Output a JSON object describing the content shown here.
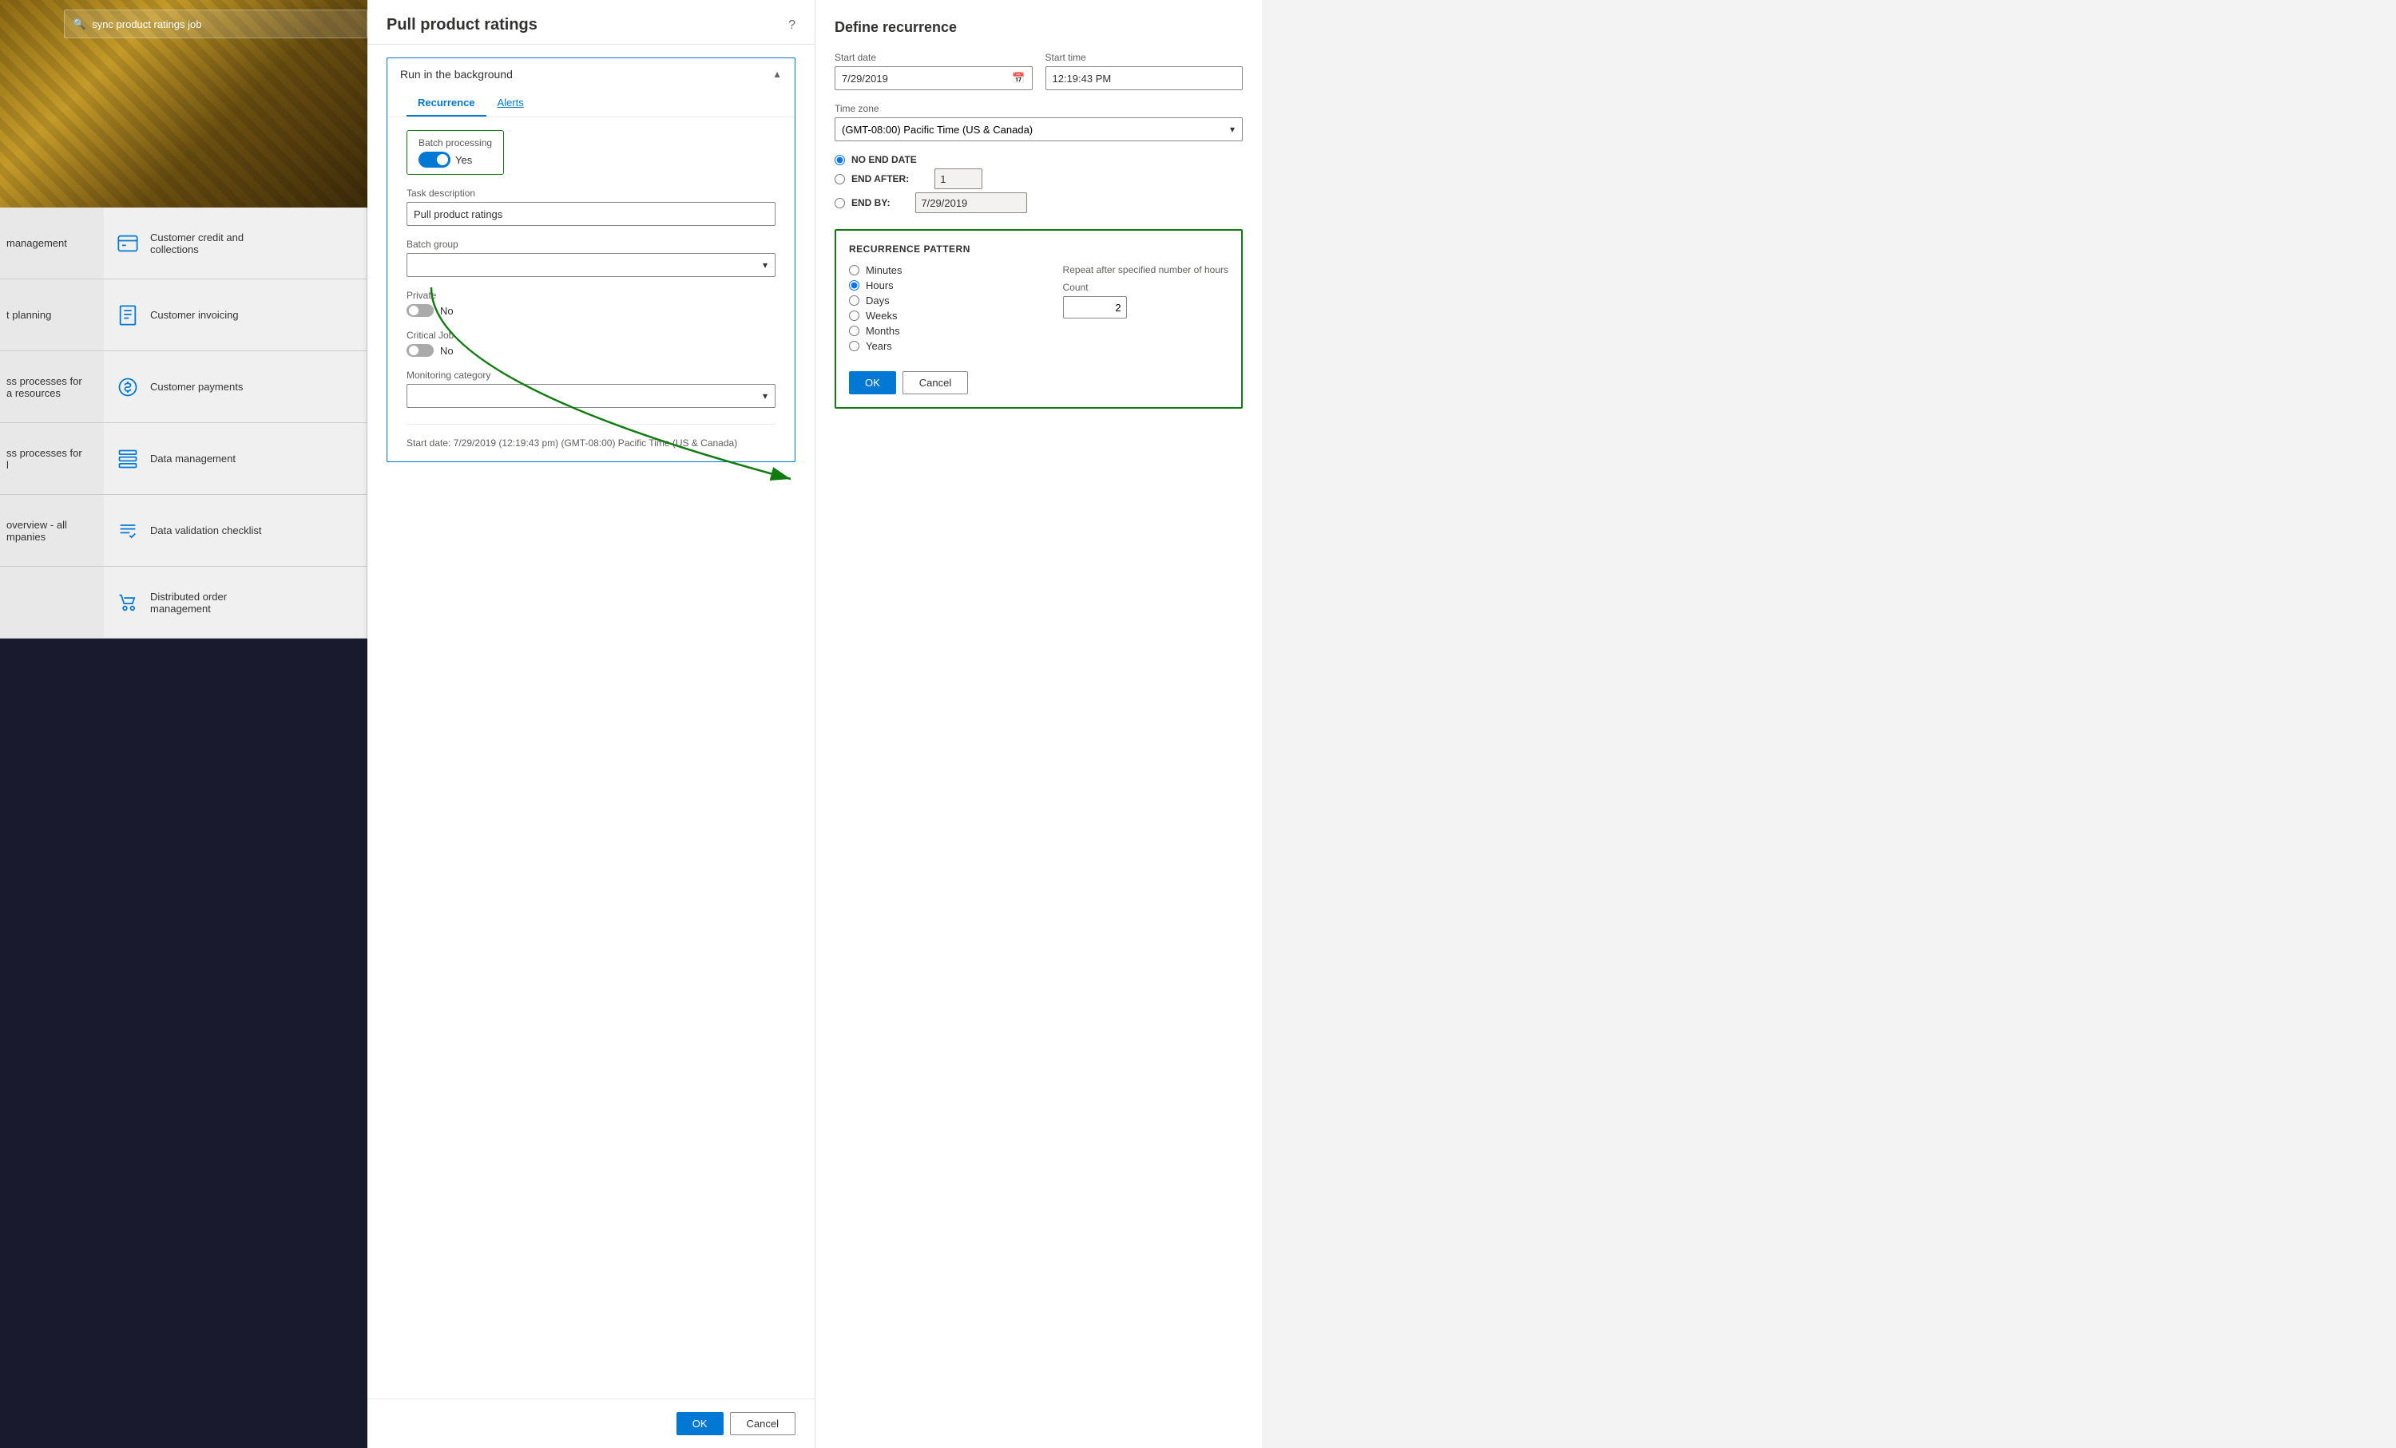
{
  "search": {
    "placeholder": "sync product ratings job",
    "value": "sync product ratings job"
  },
  "nav": {
    "left_tiles": [
      {
        "label": "management"
      },
      {
        "label": "t planning"
      },
      {
        "label": "ss processes for\na resources"
      },
      {
        "label": "ss processes for\nl"
      },
      {
        "label": "overview - all\nmpanies"
      },
      {
        "label": ""
      }
    ],
    "mid_tiles": [
      {
        "label": "Customer credit and\ncollections",
        "icon": "billing-icon"
      },
      {
        "label": "Customer invoicing",
        "icon": "invoice-icon"
      },
      {
        "label": "Customer payments",
        "icon": "payment-icon"
      },
      {
        "label": "Data management",
        "icon": "data-icon"
      },
      {
        "label": "Data validation checklist",
        "icon": "checklist-icon"
      },
      {
        "label": "Distributed order\nmanagement",
        "icon": "order-icon"
      }
    ]
  },
  "pull_dialog": {
    "title": "Pull product ratings",
    "help_icon": "?",
    "run_in_background": {
      "label": "Run in the background",
      "expanded": true
    },
    "tabs": [
      {
        "label": "Recurrence",
        "active": true
      },
      {
        "label": "Alerts",
        "active": false
      }
    ],
    "batch_processing": {
      "label": "Batch processing",
      "value": "Yes",
      "enabled": true
    },
    "task_description": {
      "label": "Task description",
      "value": "Pull product ratings"
    },
    "batch_group": {
      "label": "Batch group",
      "value": ""
    },
    "private": {
      "label": "Private",
      "value": "No",
      "enabled": false
    },
    "critical_job": {
      "label": "Critical Job",
      "value": "No",
      "enabled": false
    },
    "monitoring_category": {
      "label": "Monitoring category",
      "value": ""
    },
    "start_date_info": "Start date: 7/29/2019 (12:19:43 pm) (GMT-08:00) Pacific Time (US & Canada)",
    "ok_button": "OK",
    "cancel_button": "Cancel"
  },
  "recurrence_panel": {
    "title": "Define recurrence",
    "start_date": {
      "label": "Start date",
      "value": "7/29/2019"
    },
    "start_time": {
      "label": "Start time",
      "value": "12:19:43 PM"
    },
    "time_zone": {
      "label": "Time zone",
      "value": "(GMT-08:00) Pacific Time (US & Canada)"
    },
    "end_options": [
      {
        "label": "NO END DATE",
        "value": "no_end_date",
        "selected": true
      },
      {
        "label": "END AFTER:",
        "value": "end_after",
        "count": "1"
      },
      {
        "label": "END BY:",
        "value": "end_by",
        "date": "7/29/2019"
      }
    ],
    "recurrence_pattern": {
      "title": "RECURRENCE PATTERN",
      "repeat_label": "Repeat after specified number of hours",
      "options": [
        {
          "label": "Minutes",
          "value": "minutes",
          "selected": false
        },
        {
          "label": "Hours",
          "value": "hours",
          "selected": true
        },
        {
          "label": "Days",
          "value": "days",
          "selected": false
        },
        {
          "label": "Weeks",
          "value": "weeks",
          "selected": false
        },
        {
          "label": "Months",
          "value": "months",
          "selected": false
        },
        {
          "label": "Years",
          "value": "years",
          "selected": false
        }
      ],
      "count_label": "Count",
      "count_value": "2"
    },
    "ok_button": "OK",
    "cancel_button": "Cancel"
  }
}
